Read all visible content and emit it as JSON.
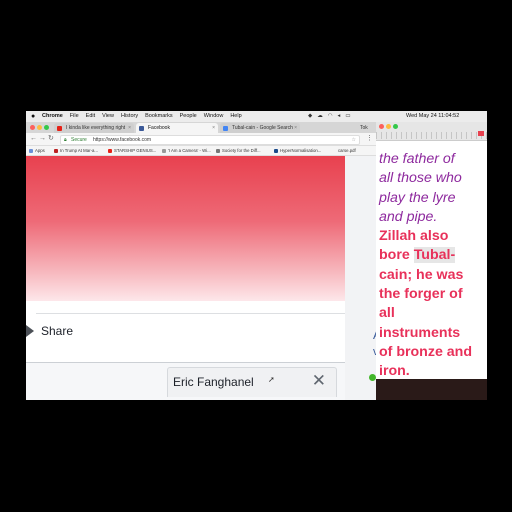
{
  "menubar": {
    "apple": "",
    "items": [
      "Chrome",
      "File",
      "Edit",
      "View",
      "History",
      "Bookmarks",
      "People",
      "Window",
      "Help"
    ],
    "clock": "Wed May 24 11:04:52"
  },
  "chrome": {
    "tabs": [
      {
        "label": "I kinda like everything right",
        "active": false
      },
      {
        "label": "Facebook",
        "active": true
      },
      {
        "label": "Tubal-cain - Google Search",
        "active": false
      }
    ],
    "user_chip": "Tok",
    "address": {
      "secure_label": "Secure",
      "url": "https://www.facebook.com"
    },
    "bookmarks": [
      "Apps",
      "In Trump At Mar-a...",
      "STARSHIP GENIUS...",
      "'I Am a Camera' - Wi...",
      "Society for the Diff...",
      "HyperNormalisation...",
      "carse.pdf"
    ]
  },
  "post": {
    "share_label": "Share"
  },
  "chat": {
    "name": "Eric Fanghanel",
    "close": "✕"
  },
  "mid": {
    "link_a": "A",
    "link_va": "va"
  },
  "reader": {
    "lines": [
      {
        "text": "the father of",
        "style": "purple"
      },
      {
        "text": "all those who",
        "style": "purple"
      },
      {
        "text": "play the lyre",
        "style": "purple"
      },
      {
        "text": "and pipe.",
        "style": "purple"
      },
      {
        "text": "Zillah also",
        "style": "red"
      },
      {
        "pre": "bore ",
        "hl": "Tubal-",
        "style": "red"
      },
      {
        "text": "cain; he was",
        "style": "red"
      },
      {
        "text": "the forger of",
        "style": "red"
      },
      {
        "text": "all",
        "style": "red"
      },
      {
        "text": "instruments",
        "style": "red"
      },
      {
        "text": "of bronze and",
        "style": "red"
      },
      {
        "text": "iron.",
        "style": "red"
      }
    ]
  },
  "colors": {
    "accent_red": "#e8315a",
    "purple": "#8e2a9e",
    "facebook_blue": "#365899"
  }
}
